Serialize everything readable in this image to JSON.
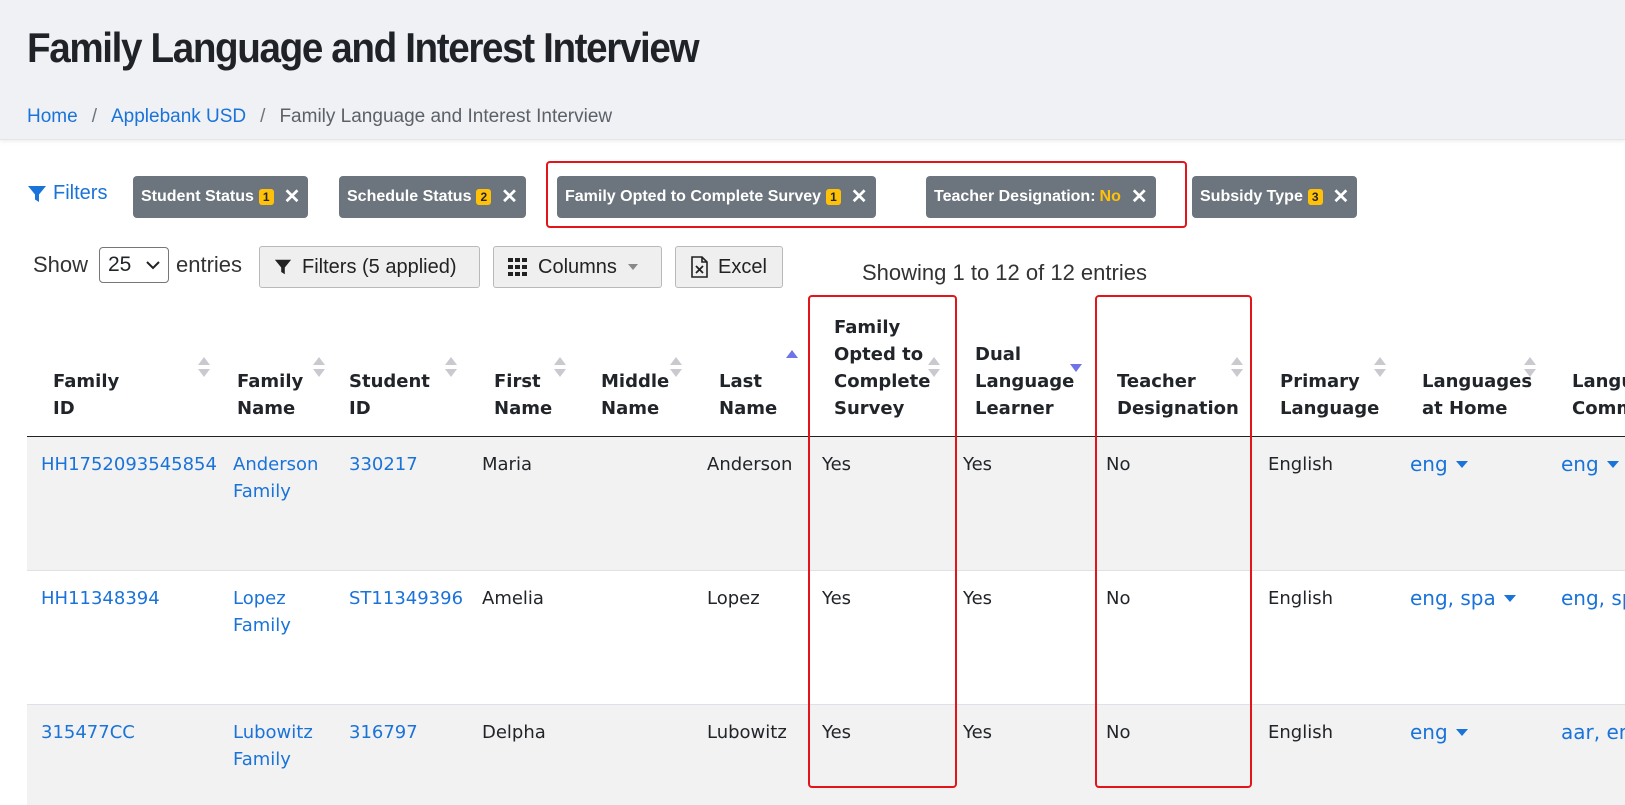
{
  "header": {
    "title": "Family Language and Interest Interview",
    "breadcrumb": {
      "home": "Home",
      "district": "Applebank USD",
      "current": "Family Language and Interest Interview",
      "separator": "/"
    }
  },
  "filters": {
    "label": "Filters",
    "chips": [
      {
        "label": "Student Status",
        "badge": "1"
      },
      {
        "label": "Schedule Status",
        "badge": "2"
      },
      {
        "label": "Family Opted to Complete Survey",
        "badge": "1"
      },
      {
        "label": "Teacher Designation:",
        "value": "No"
      },
      {
        "label": "Subsidy Type",
        "badge": "3"
      }
    ],
    "remove_glyph": "✕"
  },
  "toolbar": {
    "show_label": "Show",
    "entries_label": "entries",
    "page_size": "25",
    "filters_button": "Filters (5 applied)",
    "columns_button": "Columns",
    "excel_button": "Excel",
    "info": "Showing 1 to 12 of 12 entries"
  },
  "table": {
    "columns": [
      "Family ID",
      "Family\nName",
      "Student\nID",
      "First\nName",
      "Middle\nName",
      "Last\nName",
      "Family\nOpted to\nComplete\nSurvey",
      "Dual\nLanguage\nLearner",
      "Teacher\nDesignation",
      "Primary\nLanguage",
      "Languages\nat Home",
      "Langu\nComm"
    ],
    "rows": [
      {
        "family_id": "HH1752093545854",
        "family_name": "Anderson\nFamily",
        "student_id": "330217",
        "first": "Maria",
        "middle": "",
        "last": "Anderson",
        "opted": "Yes",
        "dll": "Yes",
        "teacher": "No",
        "primary": "English",
        "home": "eng",
        "comm": "eng"
      },
      {
        "family_id": "HH11348394",
        "family_name": "Lopez\nFamily",
        "student_id": "ST11349396",
        "first": "Amelia",
        "middle": "",
        "last": "Lopez",
        "opted": "Yes",
        "dll": "Yes",
        "teacher": "No",
        "primary": "English",
        "home": "eng, spa",
        "comm": "eng, sp"
      },
      {
        "family_id": "315477CC",
        "family_name": "Lubowitz\nFamily",
        "student_id": "316797",
        "first": "Delpha",
        "middle": "",
        "last": "Lubowitz",
        "opted": "Yes",
        "dll": "Yes",
        "teacher": "No",
        "primary": "English",
        "home": "eng",
        "comm": "aar, eng"
      }
    ]
  },
  "colors": {
    "link": "#1a73d9",
    "chip_bg": "#6c757d",
    "badge": "#ffc107",
    "highlight": "#e3151a"
  }
}
